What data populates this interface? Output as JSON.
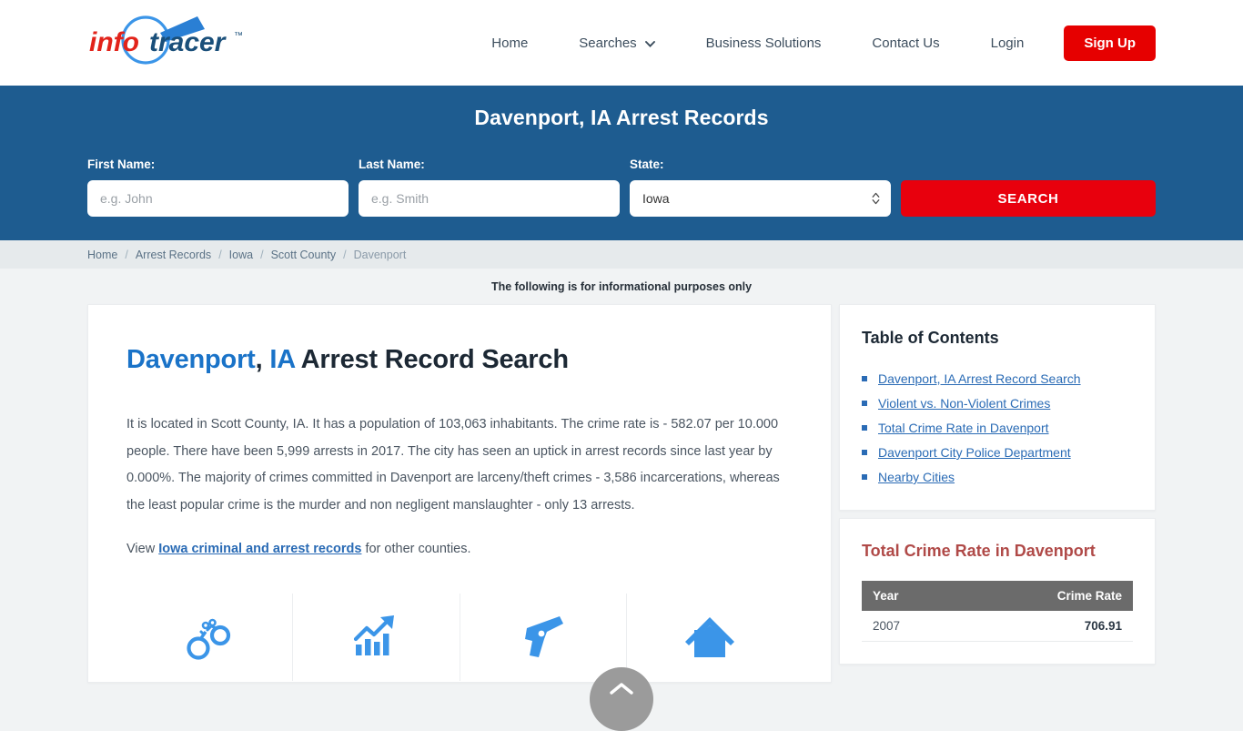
{
  "header": {
    "logo": {
      "part1": "info",
      "part2": "tracer",
      "trademark": "™",
      "icon": "magnifier-logo-icon"
    },
    "nav": [
      {
        "label": "Home",
        "name": "nav-home"
      },
      {
        "label": "Searches",
        "name": "nav-searches",
        "has_chevron": true
      },
      {
        "label": "Business Solutions",
        "name": "nav-business-solutions"
      },
      {
        "label": "Contact Us",
        "name": "nav-contact-us"
      },
      {
        "label": "Login",
        "name": "nav-login"
      }
    ],
    "signup_label": "Sign Up"
  },
  "search_banner": {
    "title": "Davenport, IA Arrest Records",
    "first_name_label": "First Name:",
    "first_name_value": "",
    "first_name_placeholder": "e.g. John",
    "last_name_label": "Last Name:",
    "last_name_value": "",
    "last_name_placeholder": "e.g. Smith",
    "state_label": "State:",
    "state_value": "Iowa",
    "search_label": "SEARCH"
  },
  "breadcrumb": [
    {
      "label": "Home",
      "current": false
    },
    {
      "label": "Arrest Records",
      "current": false
    },
    {
      "label": "Iowa",
      "current": false
    },
    {
      "label": "Scott County",
      "current": false
    },
    {
      "label": "Davenport",
      "current": true
    }
  ],
  "breadcrumb_separator": "/",
  "disclaimer": "The following is for informational purposes only",
  "main": {
    "title_city": "Davenport",
    "title_comma": ", ",
    "title_state": "IA",
    "title_rest": " Arrest Record Search",
    "paragraph1": "It is located in Scott County, IA. It has a population of 103,063 inhabitants. The crime rate is - 582.07 per 10.000 people. There have been 5,999 arrests in 2017. The city has seen an uptick in arrest records since last year by 0.000%. The majority of crimes committed in Davenport are larceny/theft crimes - 3,586 incarcerations, whereas the least popular crime is the murder and non negligent manslaughter - only 13 arrests.",
    "view_prefix": "View ",
    "view_link": "Iowa criminal and arrest records",
    "view_suffix": " for other counties.",
    "icons": [
      {
        "name": "handcuffs-icon"
      },
      {
        "name": "growth-chart-icon"
      },
      {
        "name": "handgun-icon"
      },
      {
        "name": "house-icon"
      }
    ]
  },
  "sidebar": {
    "toc_title": "Table of Contents",
    "toc_items": [
      {
        "label": "Davenport, IA Arrest Record Search"
      },
      {
        "label": "Violent vs. Non-Violent Crimes"
      },
      {
        "label": "Total Crime Rate in Davenport"
      },
      {
        "label": "Davenport City Police Department"
      },
      {
        "label": "Nearby Cities"
      }
    ],
    "table_title": "Total Crime Rate in Davenport",
    "table_headers": [
      "Year",
      "Crime Rate"
    ],
    "table_rows": [
      {
        "year": "2007",
        "rate": "706.91"
      }
    ]
  },
  "scroll_top": {
    "name": "scroll-to-top-button",
    "icon": "chevron-up-icon"
  },
  "colors": {
    "brand_blue": "#1e5c90",
    "brand_red": "#e60000",
    "link_blue": "#2a6bb5",
    "icon_blue": "#3b95e8",
    "table_header_gray": "#6b6b6b",
    "table_title_red": "#b04a48"
  }
}
